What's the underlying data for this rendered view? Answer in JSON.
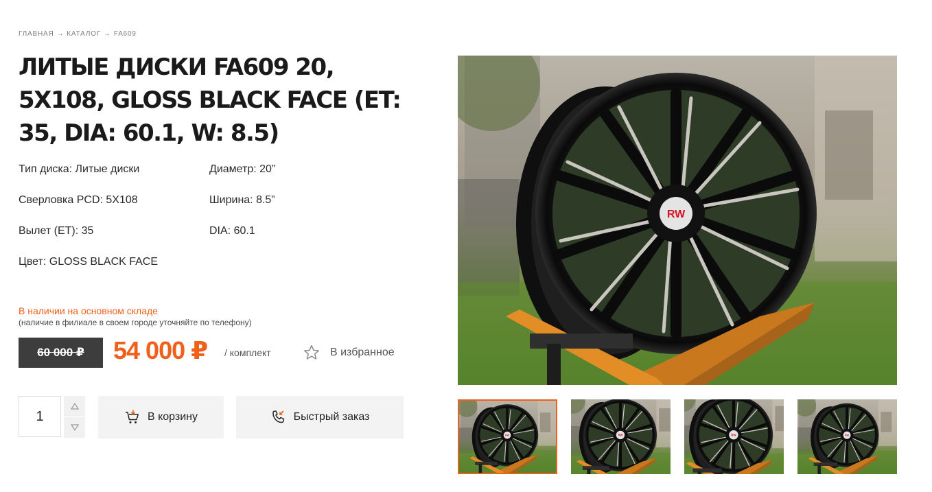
{
  "breadcrumb": {
    "items": [
      "ГЛАВНАЯ",
      "КАТАЛОГ",
      "FA609"
    ],
    "separator": "→"
  },
  "product": {
    "title": "ЛИТЫЕ ДИСКИ FA609 20, 5X108, GLOSS BLACK FACE (ET: 35, DIA: 60.1, W: 8.5)"
  },
  "specs": {
    "type": "Тип диска: Литые диски",
    "diameter": "Диаметр: 20”",
    "pcd": "Сверловка PCD: 5X108",
    "width": "Ширина: 8.5”",
    "et": "Вылет (ET): 35",
    "dia": "DIA: 60.1",
    "color": "Цвет: GLOSS BLACK FACE"
  },
  "availability": {
    "status": "В наличии на основном складе",
    "note": "(наличие в филиале в своем городе уточняйте по телефону)"
  },
  "price": {
    "old": "60 000 ₽",
    "current": "54 000 ₽",
    "unit": "/ комплект"
  },
  "favorite": {
    "label": "В избранное",
    "icon": "star-outline-icon"
  },
  "quantity": {
    "value": "1"
  },
  "buttons": {
    "cart": "В корзину",
    "quick_order": "Быстрый заказ"
  },
  "gallery": {
    "thumbnail_count": 4,
    "active_index": 0
  },
  "colors": {
    "accent": "#f0601a",
    "old_price_bg": "#3d3d3d",
    "button_bg": "#f3f3f3"
  }
}
